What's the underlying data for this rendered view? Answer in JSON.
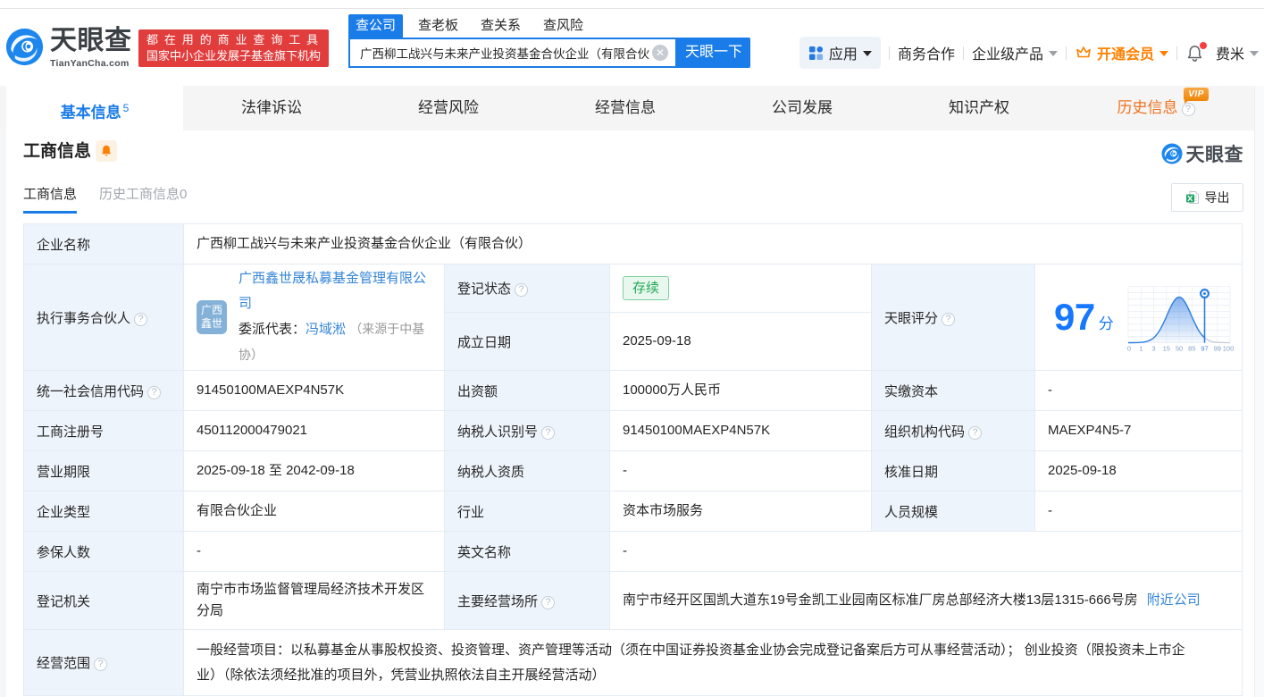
{
  "header": {
    "logo": {
      "title": "天眼查",
      "domain": "TianYanCha.com"
    },
    "slogan": {
      "line1": "都在用的商业查询工具",
      "line2": "国家中小企业发展子基金旗下机构"
    },
    "search": {
      "tabs": [
        {
          "label": "查公司",
          "active": true
        },
        {
          "label": "查老板",
          "active": false
        },
        {
          "label": "查关系",
          "active": false
        },
        {
          "label": "查风险",
          "active": false
        }
      ],
      "value": "广西柳工战兴与未来产业投资基金合伙企业（有限合伙",
      "button": "天眼一下"
    },
    "menu": {
      "apps": "应用",
      "cooperation": "商务合作",
      "enterprise": "企业级产品",
      "vip": "开通会员",
      "user": "费米"
    }
  },
  "nav": {
    "tabs": [
      {
        "label": "基本信息",
        "count": "5",
        "active": true
      },
      {
        "label": "法律诉讼"
      },
      {
        "label": "经营风险"
      },
      {
        "label": "经营信息"
      },
      {
        "label": "公司发展"
      },
      {
        "label": "知识产权"
      },
      {
        "label": "历史信息",
        "badge": "VIP"
      }
    ]
  },
  "section": {
    "title": "工商信息",
    "watermark": "天眼查",
    "subtabs": [
      {
        "label": "工商信息",
        "active": true
      },
      {
        "label": "历史工商信息0",
        "active": false
      }
    ],
    "export_label": "导出"
  },
  "fields": {
    "company_name": {
      "label": "企业名称",
      "value": "广西柳工战兴与未来产业投资基金合伙企业（有限合伙）"
    },
    "partner": {
      "label": "执行事务合伙人",
      "logo_line1": "广西",
      "logo_line2": "鑫世",
      "company": "广西鑫世晟私募基金管理有限公司",
      "rep_label": "委派代表：",
      "rep_name": "冯域淞",
      "rep_source": "（来源于中基协）"
    },
    "reg_status": {
      "label": "登记状态",
      "value": "存续"
    },
    "establish_date": {
      "label": "成立日期",
      "value": "2025-09-18"
    },
    "credit_code": {
      "label": "统一社会信用代码",
      "value": "91450100MAEXP4N57K"
    },
    "capital": {
      "label": "出资额",
      "value": "100000万人民币"
    },
    "paid_capital": {
      "label": "实缴资本",
      "value": "-"
    },
    "reg_number": {
      "label": "工商注册号",
      "value": "450112000479021"
    },
    "taxpayer_id": {
      "label": "纳税人识别号",
      "value": "91450100MAEXP4N57K"
    },
    "org_code": {
      "label": "组织机构代码",
      "value": "MAEXP4N5-7"
    },
    "business_term": {
      "label": "营业期限",
      "value": "2025-09-18 至 2042-09-18"
    },
    "taxpayer_quality": {
      "label": "纳税人资质",
      "value": "-"
    },
    "approval_date": {
      "label": "核准日期",
      "value": "2025-09-18"
    },
    "company_type": {
      "label": "企业类型",
      "value": "有限合伙企业"
    },
    "industry": {
      "label": "行业",
      "value": "资本市场服务"
    },
    "staff_size": {
      "label": "人员规模",
      "value": "-"
    },
    "insured_count": {
      "label": "参保人数",
      "value": "-"
    },
    "english_name": {
      "label": "英文名称",
      "value": "-"
    },
    "reg_authority": {
      "label": "登记机关",
      "value": "南宁市市场监督管理局经济技术开发区分局"
    },
    "business_address": {
      "label": "主要经营场所",
      "value": "南宁市经开区国凯大道东19号金凯工业园南区标准厂房总部经济大楼13层1315-666号房",
      "nearby": "附近公司"
    },
    "business_scope": {
      "label": "经营范围",
      "value": "一般经营项目：以私募基金从事股权投资、投资管理、资产管理等活动（须在中国证券投资基金业协会完成登记备案后方可从事经营活动）； 创业投资（限投资未上市企业）（除依法须经批准的项目外，凭营业执照依法自主开展经营活动）"
    }
  },
  "score": {
    "label": "天眼评分",
    "value": "97",
    "unit": "分",
    "chart_data": {
      "type": "area",
      "title": "天眼评分分布曲线",
      "ticks": [
        "0",
        "1",
        "3",
        "15",
        "50",
        "85",
        "97",
        "99",
        "100"
      ],
      "marker_value": "97"
    }
  },
  "colors": {
    "brand_blue": "#1a7ce8",
    "link_blue": "#3585d8",
    "score_blue": "#1678ff",
    "vip_orange": "#ff8000",
    "slogan_red": "#e23d3d",
    "status_green": "#23a757"
  }
}
